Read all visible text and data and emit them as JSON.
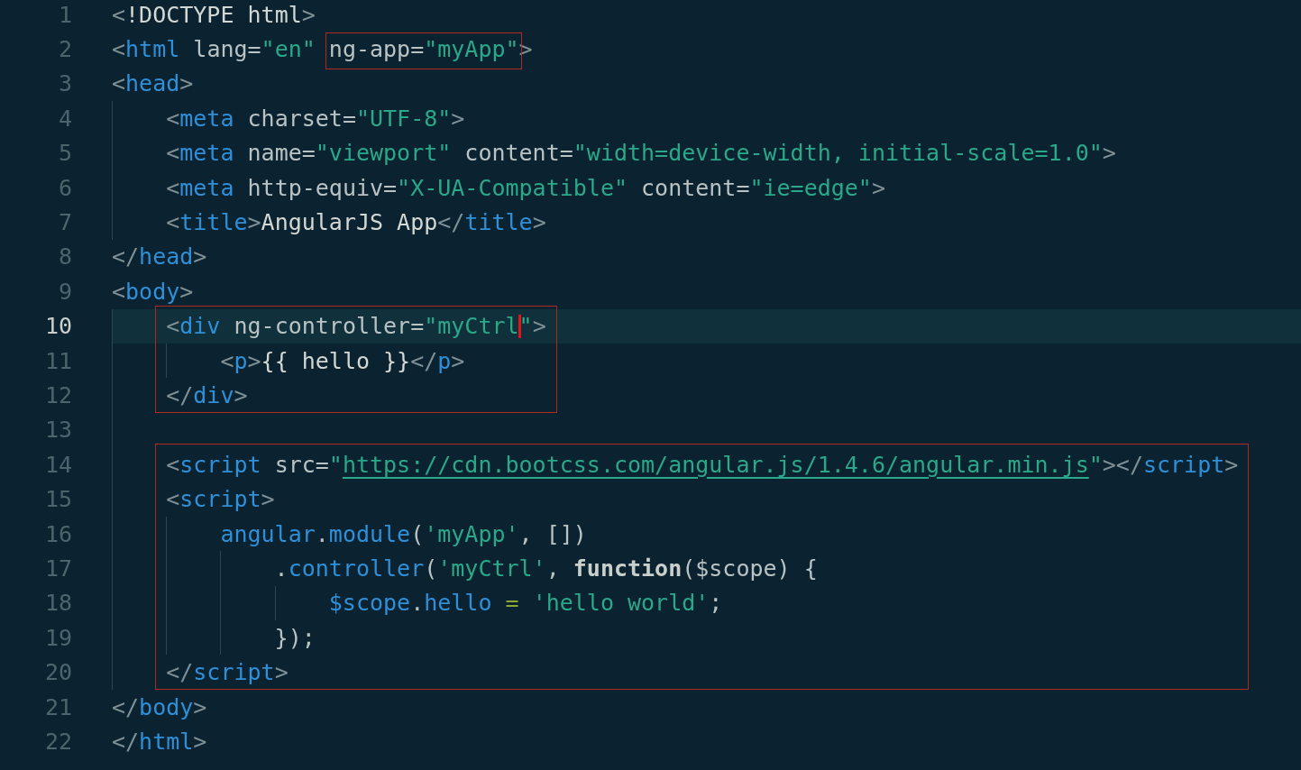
{
  "editor": {
    "blocks": [
      {
        "boxed": false,
        "lines": [
          {
            "number": "1",
            "current": false,
            "tokens": [
              {
                "kind": "bracket",
                "text": "<"
              },
              {
                "kind": "text",
                "text": "!DOCTYPE html"
              },
              {
                "kind": "bracket",
                "text": ">"
              }
            ]
          },
          {
            "number": "2",
            "current": false,
            "tokens": [
              {
                "kind": "bracket",
                "text": "<"
              },
              {
                "kind": "tag",
                "text": "html"
              },
              {
                "kind": "attr",
                "text": " lang="
              },
              {
                "kind": "string",
                "text": "\"en\" "
              },
              {
                "kind": "attr",
                "text": "ng-app=",
                "boxed": true
              },
              {
                "kind": "string",
                "text": "\"myApp\"",
                "boxed": true
              },
              {
                "kind": "bracket",
                "text": ">"
              }
            ]
          },
          {
            "number": "3",
            "current": false,
            "tokens": [
              {
                "kind": "bracket",
                "text": "<"
              },
              {
                "kind": "tag",
                "text": "head"
              },
              {
                "kind": "bracket",
                "text": ">"
              }
            ]
          },
          {
            "number": "4",
            "current": false,
            "tokens": [
              {
                "kind": "bracket",
                "text": "    <"
              },
              {
                "kind": "tag",
                "text": "meta"
              },
              {
                "kind": "attr",
                "text": " charset="
              },
              {
                "kind": "string",
                "text": "\"UTF-8\""
              },
              {
                "kind": "bracket",
                "text": ">"
              }
            ]
          },
          {
            "number": "5",
            "current": false,
            "tokens": [
              {
                "kind": "bracket",
                "text": "    <"
              },
              {
                "kind": "tag",
                "text": "meta"
              },
              {
                "kind": "attr",
                "text": " name="
              },
              {
                "kind": "string",
                "text": "\"viewport\""
              },
              {
                "kind": "attr",
                "text": " content="
              },
              {
                "kind": "string",
                "text": "\"width=device-width, initial-scale=1.0\""
              },
              {
                "kind": "bracket",
                "text": ">"
              }
            ]
          },
          {
            "number": "6",
            "current": false,
            "tokens": [
              {
                "kind": "bracket",
                "text": "    <"
              },
              {
                "kind": "tag",
                "text": "meta"
              },
              {
                "kind": "attr",
                "text": " http-equiv="
              },
              {
                "kind": "string",
                "text": "\"X-UA-Compatible\""
              },
              {
                "kind": "attr",
                "text": " content="
              },
              {
                "kind": "string",
                "text": "\"ie=edge\""
              },
              {
                "kind": "bracket",
                "text": ">"
              }
            ]
          },
          {
            "number": "7",
            "current": false,
            "tokens": [
              {
                "kind": "bracket",
                "text": "    <"
              },
              {
                "kind": "tag",
                "text": "title"
              },
              {
                "kind": "bracket",
                "text": ">"
              },
              {
                "kind": "text",
                "text": "AngularJS App"
              },
              {
                "kind": "bracket",
                "text": "</"
              },
              {
                "kind": "tag",
                "text": "title"
              },
              {
                "kind": "bracket",
                "text": ">"
              }
            ]
          },
          {
            "number": "8",
            "current": false,
            "tokens": [
              {
                "kind": "bracket",
                "text": "</"
              },
              {
                "kind": "tag",
                "text": "head"
              },
              {
                "kind": "bracket",
                "text": ">"
              }
            ]
          },
          {
            "number": "9",
            "current": false,
            "tokens": [
              {
                "kind": "bracket",
                "text": "<"
              },
              {
                "kind": "tag",
                "text": "body"
              },
              {
                "kind": "bracket",
                "text": ">"
              }
            ]
          }
        ]
      },
      {
        "boxed": true,
        "lines": [
          {
            "number": "10",
            "current": true,
            "tokens": [
              {
                "kind": "bracket",
                "text": "    <"
              },
              {
                "kind": "tag",
                "text": "div"
              },
              {
                "kind": "attr",
                "text": " ng-controller="
              },
              {
                "kind": "string",
                "text": "\"myCtrl",
                "cursor_after": true
              },
              {
                "kind": "string",
                "text": "\""
              },
              {
                "kind": "bracket",
                "text": ">"
              }
            ]
          },
          {
            "number": "11",
            "current": false,
            "tokens": [
              {
                "kind": "bracket",
                "text": "        <"
              },
              {
                "kind": "tag",
                "text": "p"
              },
              {
                "kind": "bracket",
                "text": ">"
              },
              {
                "kind": "text",
                "text": "{{ hello }}"
              },
              {
                "kind": "bracket",
                "text": "</"
              },
              {
                "kind": "tag",
                "text": "p"
              },
              {
                "kind": "bracket",
                "text": ">"
              }
            ]
          },
          {
            "number": "12",
            "current": false,
            "tokens": [
              {
                "kind": "bracket",
                "text": "    </"
              },
              {
                "kind": "tag",
                "text": "div"
              },
              {
                "kind": "bracket",
                "text": ">"
              }
            ]
          }
        ]
      },
      {
        "boxed": false,
        "lines": [
          {
            "number": "13",
            "current": false
          }
        ]
      },
      {
        "boxed": true,
        "lines": [
          {
            "number": "14",
            "current": false,
            "tokens": [
              {
                "kind": "bracket",
                "text": "    <"
              },
              {
                "kind": "tag",
                "text": "script"
              },
              {
                "kind": "attr",
                "text": " src="
              },
              {
                "kind": "string",
                "text": "\""
              },
              {
                "kind": "link",
                "text": "https://cdn.bootcss.com/angular.js/1.4.6/angular.min.js"
              },
              {
                "kind": "string",
                "text": "\""
              },
              {
                "kind": "bracket",
                "text": "></"
              },
              {
                "kind": "tag",
                "text": "script"
              },
              {
                "kind": "bracket",
                "text": ">"
              }
            ]
          },
          {
            "number": "15",
            "current": false,
            "tokens": [
              {
                "kind": "bracket",
                "text": "    <"
              },
              {
                "kind": "tag",
                "text": "script"
              },
              {
                "kind": "bracket",
                "text": ">"
              }
            ]
          },
          {
            "number": "16",
            "current": false,
            "tokens": [
              {
                "kind": "ident",
                "text": "        angular"
              },
              {
                "kind": "punct",
                "text": "."
              },
              {
                "kind": "ident",
                "text": "module"
              },
              {
                "kind": "punct",
                "text": "("
              },
              {
                "kind": "string",
                "text": "'myApp'"
              },
              {
                "kind": "punct",
                "text": ", [])"
              }
            ]
          },
          {
            "number": "17",
            "current": false,
            "tokens": [
              {
                "kind": "punct",
                "text": "            ."
              },
              {
                "kind": "ident",
                "text": "controller"
              },
              {
                "kind": "punct",
                "text": "("
              },
              {
                "kind": "string",
                "text": "'myCtrl'"
              },
              {
                "kind": "punct",
                "text": ", "
              },
              {
                "kind": "keyword",
                "text": "function"
              },
              {
                "kind": "punct",
                "text": "($scope) {"
              }
            ]
          },
          {
            "number": "18",
            "current": false,
            "tokens": [
              {
                "kind": "ident",
                "text": "                $scope"
              },
              {
                "kind": "punct",
                "text": "."
              },
              {
                "kind": "ident",
                "text": "hello"
              },
              {
                "kind": "operator",
                "text": " = "
              },
              {
                "kind": "string",
                "text": "'hello world'"
              },
              {
                "kind": "punct",
                "text": ";"
              }
            ]
          },
          {
            "number": "19",
            "current": false,
            "tokens": [
              {
                "kind": "punct",
                "text": "            });"
              }
            ]
          },
          {
            "number": "20",
            "current": false,
            "tokens": [
              {
                "kind": "bracket",
                "text": "    </"
              },
              {
                "kind": "tag",
                "text": "script"
              },
              {
                "kind": "bracket",
                "text": ">"
              }
            ]
          }
        ]
      },
      {
        "boxed": false,
        "lines": [
          {
            "number": "21",
            "current": false,
            "tokens": [
              {
                "kind": "bracket",
                "text": "</"
              },
              {
                "kind": "tag",
                "text": "body"
              },
              {
                "kind": "bracket",
                "text": ">"
              }
            ]
          },
          {
            "number": "22",
            "current": false,
            "tokens": [
              {
                "kind": "bracket",
                "text": "</"
              },
              {
                "kind": "tag",
                "text": "html"
              },
              {
                "kind": "bracket",
                "text": ">"
              }
            ]
          }
        ]
      }
    ]
  }
}
